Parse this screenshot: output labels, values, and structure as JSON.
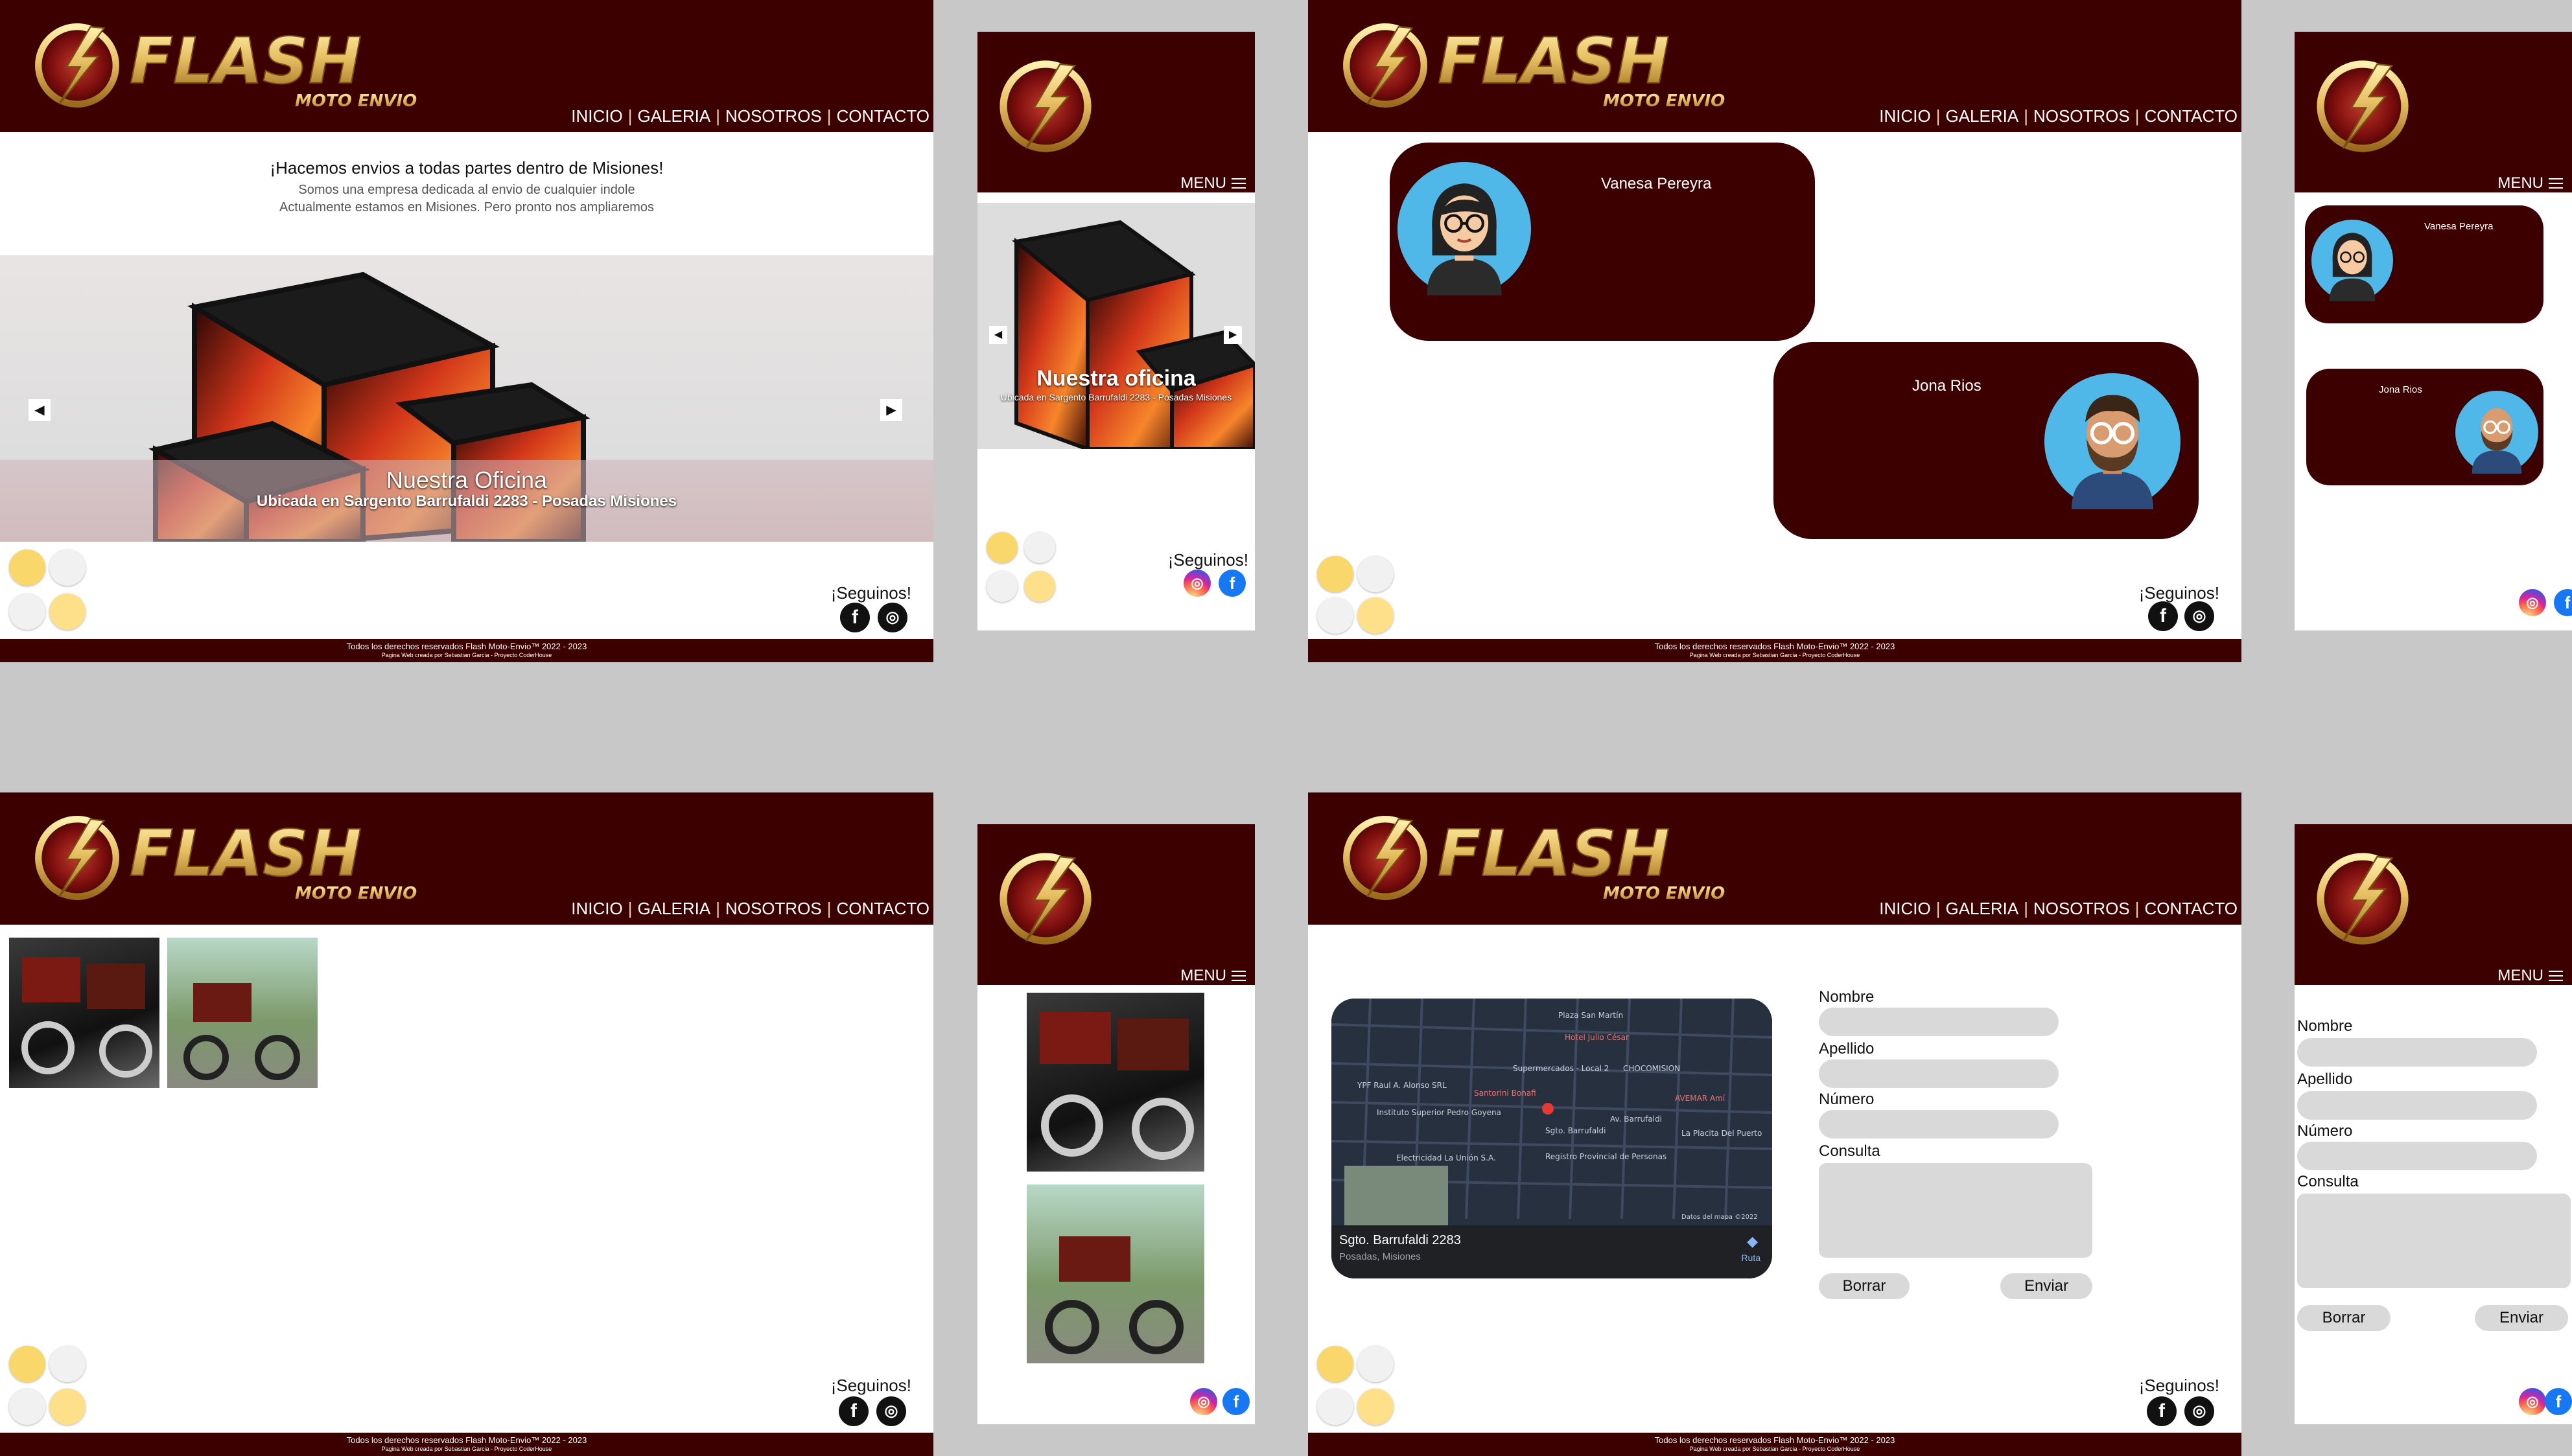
{
  "brand": {
    "name": "FLASH",
    "tagline": "MOTO ENVIO"
  },
  "nav": {
    "items": [
      "INICIO",
      "GALERIA",
      "NOSOTROS",
      "CONTACTO"
    ],
    "menu_label": "MENU"
  },
  "home": {
    "headline": "¡Hacemos envios a todas partes dentro de Misiones!",
    "sub1": "Somos una empresa dedicada al envio de cualquier indole",
    "sub2": "Actualmente estamos en Misiones. Pero pronto nos ampliaremos",
    "slide_title": "Nuestra Oficina",
    "slide_caption": "Ubicada en Sargento Barrufaldi 2283 - Posadas Misiones",
    "mobile_slide_title": "Nuestra oficina",
    "mobile_slide_caption": "Ubicada en Sargento Barrufaldi 2283 - Posadas Misiones"
  },
  "social": {
    "label": "¡Seguinos!"
  },
  "footer": {
    "line1": "Todos los derechos reservados Flash Moto-Envio™ 2022 - 2023",
    "line2": "Pagina Web creada por Sebastian Garcia - Proyecto CoderHouse"
  },
  "team": {
    "members": [
      "Vanesa Pereyra",
      "Jona Rios"
    ]
  },
  "contact": {
    "fields": [
      "Nombre",
      "Apellido",
      "Número",
      "Consulta"
    ],
    "reset_label": "Borrar",
    "submit_label": "Enviar",
    "map_address": "Sgto. Barrufaldi 2283",
    "map_city": "Posadas, Misiones",
    "map_route": "Ruta",
    "map_data": "Datos del mapa ©2022",
    "map_places": [
      "Plaza San Martín",
      "Hotel Julio César",
      "CHOCOMISION",
      "Supermercados - Local 2",
      "YPF Raul A. Alonso SRL",
      "Instituto Superior Pedro Goyena",
      "Santorini Bonafi",
      "AVEMAR Amí",
      "La Placita Del Puerto",
      "Electricidad La Unión S.A.",
      "Registro Provincial de Personas",
      "Sgto. Barrufaldi",
      "Av. Barrufaldi"
    ]
  },
  "colors": {
    "brand": "#3c0000",
    "gold": "#e7c063",
    "board": "#c8c8c8"
  }
}
